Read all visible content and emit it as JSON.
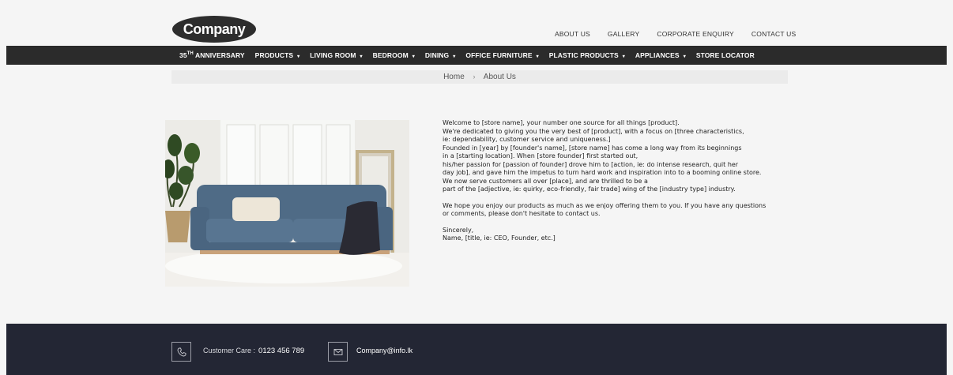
{
  "header": {
    "logo_text": "Company",
    "top_links": [
      "ABOUT US",
      "GALLERY",
      "CORPORATE ENQUIRY",
      "CONTACT US"
    ]
  },
  "nav": {
    "anniversary_num": "35",
    "anniversary_sup": "th",
    "anniversary_label": " ANNIVERSARY",
    "items": [
      {
        "label": "PRODUCTS",
        "caret": "▾"
      },
      {
        "label": "LIVING ROOM",
        "caret": "▾"
      },
      {
        "label": "BEDROOM",
        "caret": "▾"
      },
      {
        "label": "DINING",
        "caret": "▾"
      },
      {
        "label": "OFFICE FURNITURE",
        "caret": "▾"
      },
      {
        "label": "PLASTIC PRODUCTS",
        "caret": "▾"
      },
      {
        "label": "APPLIANCES",
        "caret": "▾"
      },
      {
        "label": "STORE LOCATOR",
        "caret": ""
      }
    ]
  },
  "breadcrumb": {
    "home": "Home",
    "separator": "›",
    "current": "About Us"
  },
  "about": {
    "lines_p1": [
      "Welcome to [store name], your number one source for all things [product].",
      "We're dedicated to giving you the very best of [product], with a focus on [three characteristics,",
      "ie: dependability, customer service and uniqueness.]",
      "Founded in [year] by [founder's name], [store name] has come a long way from its beginnings",
      "in a [starting location]. When [store founder] first started out,",
      "his/her passion for [passion of founder] drove him to [action, ie: do intense research, quit her",
      "day job], and gave him the impetus to turn hard work and inspiration into to a booming online store.",
      "We now serve customers all over [place], and are thrilled to be a",
      "part of the [adjective, ie: quirky, eco-friendly, fair trade] wing of the [industry type] industry."
    ],
    "lines_p2": [
      "We hope you enjoy our products as much as we enjoy offering them to you. If you have any questions",
      "or comments, please don't hesitate to contact us."
    ],
    "lines_p3": [
      "Sincerely,",
      "Name, [title, ie: CEO, Founder, etc.]"
    ]
  },
  "footer": {
    "care_label": "Customer Care :",
    "care_phone": "0123 456 789",
    "email": "Company@info.lk"
  },
  "colors": {
    "navbar": "#2b2b2b",
    "footer": "#232634",
    "background": "#f5f5f5"
  },
  "icons": {
    "phone": "phone-icon",
    "email": "envelope-icon"
  }
}
